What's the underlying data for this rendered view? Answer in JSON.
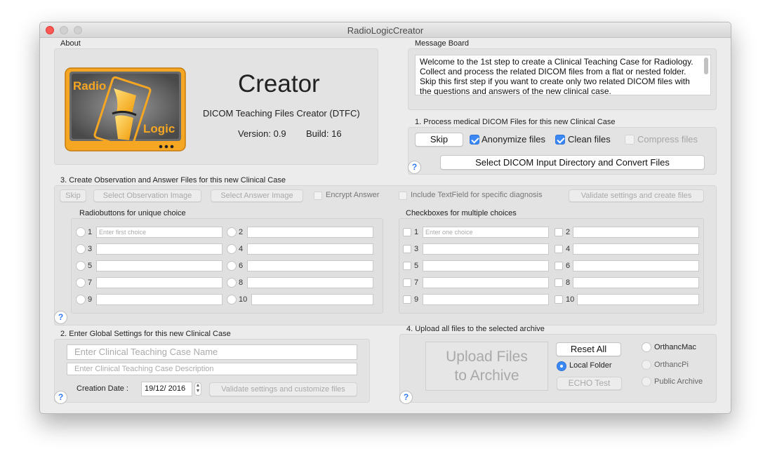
{
  "window": {
    "title": "RadioLogicCreator"
  },
  "about": {
    "label": "About",
    "app_name": "Creator",
    "subtitle": "DICOM Teaching Files Creator (DTFC)",
    "version": "Version: 0.9",
    "build": "Build: 16",
    "logo_word1": "Radio",
    "logo_word2": "Logic"
  },
  "message_board": {
    "label": "Message Board",
    "text": "Welcome to the 1st step to create a Clinical Teaching Case for Radiology. Collect and process the related DICOM files from a flat or nested folder. Skip this first step if you want to create only two related DICOM files with the questions and answers of the new clinical case."
  },
  "step1": {
    "label": "1. Process medical DICOM Files for this new Clinical Case",
    "skip": "Skip",
    "anonymize": {
      "label": "Anonymize files",
      "checked": true
    },
    "clean": {
      "label": "Clean files",
      "checked": true
    },
    "compress": {
      "label": "Compress files",
      "checked": false,
      "enabled": false
    },
    "select_button": "Select DICOM Input Directory and Convert Files"
  },
  "step3": {
    "label": "3. Create Observation and Answer Files for this new Clinical Case",
    "skip": "Skip",
    "select_observation": "Select Observation Image",
    "select_answer": "Select Answer Image",
    "encrypt": "Encrypt Answer",
    "include_textfield": "Include TextField for specific diagnosis",
    "validate": "Validate settings and create files",
    "radio_label": "Radiobuttons for unique choice",
    "checkbox_label": "Checkboxes for multiple choices",
    "radio_placeholder": "Enter first choice",
    "checkbox_placeholder": "Enter one choice",
    "choice_numbers": [
      "1",
      "2",
      "3",
      "4",
      "5",
      "6",
      "7",
      "8",
      "9",
      "10"
    ]
  },
  "step2": {
    "label": "2. Enter Global Settings for this new Clinical Case",
    "name_placeholder": "Enter Clinical Teaching Case Name",
    "description_placeholder": "Enter Clinical Teaching Case Description",
    "date_label": "Creation Date :",
    "date_value": "19/12/ 2016",
    "validate": "Validate settings and customize files"
  },
  "step4": {
    "label": "4. Upload all files to the selected archive",
    "upload": "Upload Files to Archive",
    "reset": "Reset All",
    "local_folder": "Local Folder",
    "echo": "ECHO Test",
    "orthanc_mac": "OrthancMac",
    "orthanc_pi": "OrthancPi",
    "public_archive": "Public Archive",
    "selected_destination": "Local Folder"
  },
  "help": "?",
  "colors": {
    "accent": "#3b88f5",
    "logo_orange": "#f5a623",
    "close": "#fc5753"
  }
}
